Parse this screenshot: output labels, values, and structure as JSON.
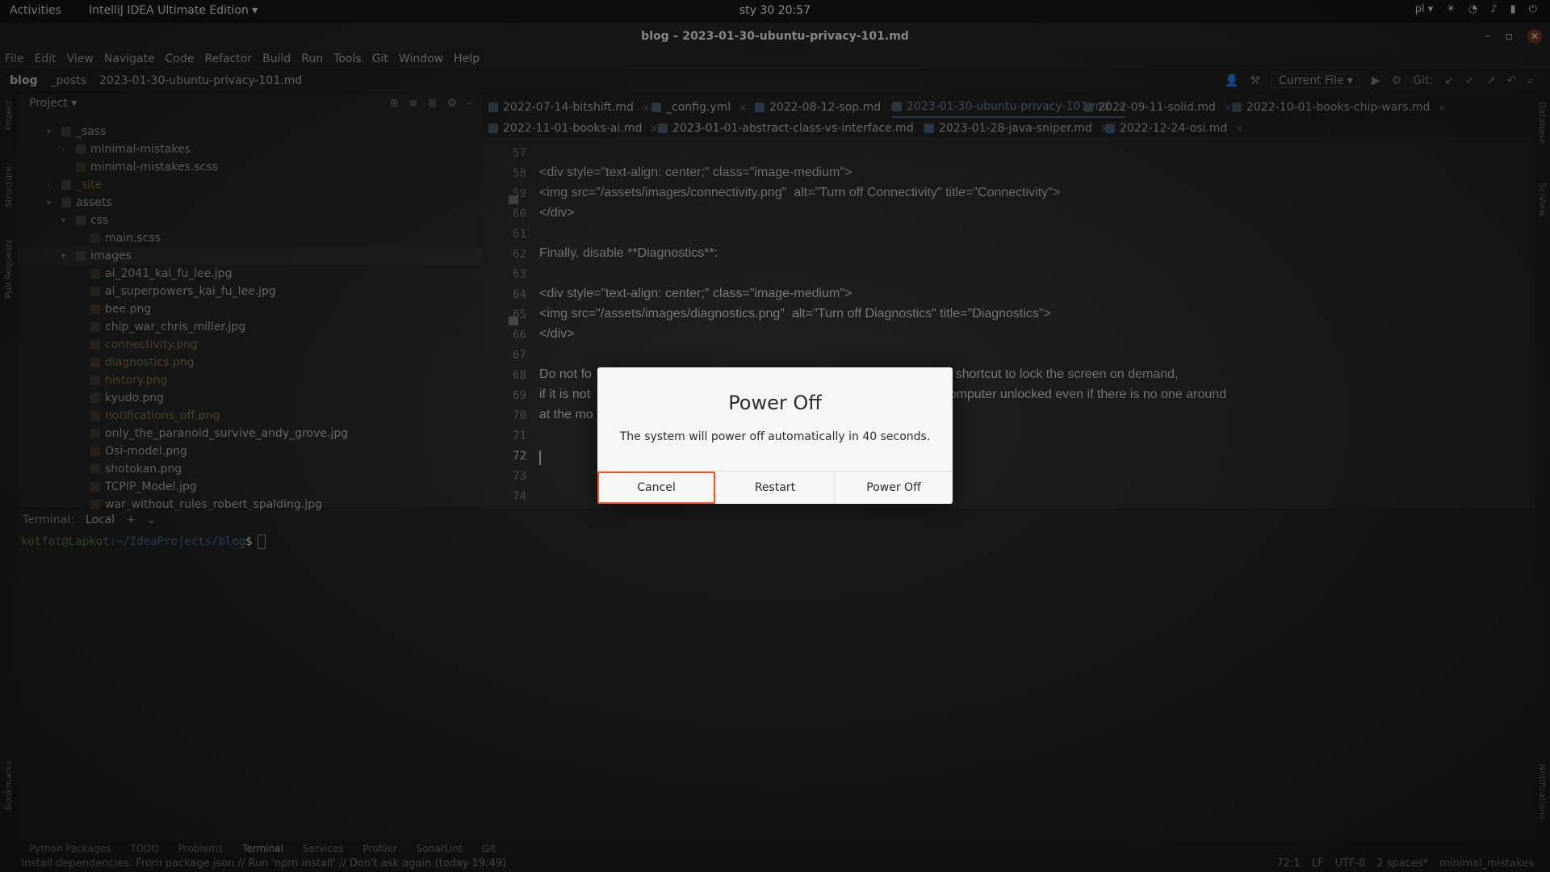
{
  "topbar": {
    "activities": "Activities",
    "app_menu": "IntelliJ IDEA Ultimate Edition ▾",
    "clock": "sty 30  20:57",
    "lang": "pl ▾"
  },
  "window": {
    "title": "blog – 2023-01-30-ubuntu-privacy-101.md"
  },
  "menu": [
    "File",
    "Edit",
    "View",
    "Navigate",
    "Code",
    "Refactor",
    "Build",
    "Run",
    "Tools",
    "Git",
    "Window",
    "Help"
  ],
  "navbar": {
    "crumbs": [
      "blog",
      "_posts",
      "2023-01-30-ubuntu-privacy-101.md"
    ],
    "run_config": "Current File ▾",
    "git_label": "Git:"
  },
  "project": {
    "header": "Project ▾",
    "rows": [
      {
        "label": "_sass",
        "indent": 1,
        "type": "folder",
        "open": true
      },
      {
        "label": "minimal-mistakes",
        "indent": 2,
        "type": "folder",
        "open": false
      },
      {
        "label": "minimal-mistakes.scss",
        "indent": 2,
        "type": "file"
      },
      {
        "label": "_site",
        "indent": 1,
        "type": "folder",
        "open": false,
        "dim": true
      },
      {
        "label": "assets",
        "indent": 1,
        "type": "folder",
        "open": true
      },
      {
        "label": "css",
        "indent": 2,
        "type": "folder",
        "open": true
      },
      {
        "label": "main.scss",
        "indent": 3,
        "type": "file"
      },
      {
        "label": "images",
        "indent": 2,
        "type": "folder",
        "open": true,
        "selected": true
      },
      {
        "label": "ai_2041_kai_fu_lee.jpg",
        "indent": 3,
        "type": "file"
      },
      {
        "label": "ai_superpowers_kai_fu_lee.jpg",
        "indent": 3,
        "type": "file"
      },
      {
        "label": "bee.png",
        "indent": 3,
        "type": "file"
      },
      {
        "label": "chip_war_chris_miller.jpg",
        "indent": 3,
        "type": "file"
      },
      {
        "label": "connectivity.png",
        "indent": 3,
        "type": "file",
        "dim": true
      },
      {
        "label": "diagnostics.png",
        "indent": 3,
        "type": "file",
        "dim": true
      },
      {
        "label": "history.png",
        "indent": 3,
        "type": "file",
        "dim": true
      },
      {
        "label": "kyudo.png",
        "indent": 3,
        "type": "file"
      },
      {
        "label": "notifications_off.png",
        "indent": 3,
        "type": "file",
        "dim": true
      },
      {
        "label": "only_the_paranoid_survive_andy_grove.jpg",
        "indent": 3,
        "type": "file"
      },
      {
        "label": "Osi-model.png",
        "indent": 3,
        "type": "file"
      },
      {
        "label": "shotokan.png",
        "indent": 3,
        "type": "file"
      },
      {
        "label": "TCPIP_Model.jpg",
        "indent": 3,
        "type": "file"
      },
      {
        "label": "war_without_rules_robert_spalding.jpg",
        "indent": 3,
        "type": "file"
      }
    ]
  },
  "tabs": [
    {
      "label": "2022-07-14-bitshift.md",
      "active": false
    },
    {
      "label": "_config.yml",
      "active": false
    },
    {
      "label": "2022-08-12-sop.md",
      "active": false
    },
    {
      "label": "2023-01-30-ubuntu-privacy-101.md",
      "active": true
    },
    {
      "label": "2022-09-11-solid.md",
      "active": false
    },
    {
      "label": "2022-10-01-books-chip-wars.md",
      "active": false
    },
    {
      "label": "2022-11-01-books-ai.md",
      "active": false
    },
    {
      "label": "2023-01-01-abstract-class-vs-interface.md",
      "active": false
    },
    {
      "label": "2023-01-28-java-sniper.md",
      "active": false
    },
    {
      "label": "2022-12-24-osi.md",
      "active": false
    }
  ],
  "editor": {
    "lines": [
      {
        "n": "57",
        "text": ""
      },
      {
        "n": "58",
        "text": "<div style=\"text-align: center;\" class=\"image-medium\">"
      },
      {
        "n": "59",
        "text": "<img src=\"/assets/images/connectivity.png\"  alt=\"Turn off Connectivity\" title=\"Connectivity\">"
      },
      {
        "n": "60",
        "text": "</div>"
      },
      {
        "n": "61",
        "text": ""
      },
      {
        "n": "62",
        "text": "Finally, disable **Diagnostics**:"
      },
      {
        "n": "63",
        "text": ""
      },
      {
        "n": "64",
        "text": "<div style=\"text-align: center;\" class=\"image-medium\">"
      },
      {
        "n": "65",
        "text": "<img src=\"/assets/images/diagnostics.png\"  alt=\"Turn off Diagnostics\" title=\"Diagnostics\">"
      },
      {
        "n": "66",
        "text": "</div>"
      },
      {
        "n": "67",
        "text": ""
      },
      {
        "n": "68",
        "text": "Do not fo                                                                        n useful keyboard shortcut to lock the screen on demand,"
      },
      {
        "n": "69",
        "text": "if it is not                                                                     Do not leave your computer unlocked even if there is no one around"
      },
      {
        "n": "70",
        "text": "at the mo"
      },
      {
        "n": "71",
        "text": ""
      },
      {
        "n": "72",
        "text": ""
      },
      {
        "n": "73",
        "text": ""
      },
      {
        "n": "74",
        "text": ""
      }
    ]
  },
  "terminal": {
    "label": "Terminal:",
    "tab": "Local",
    "user": "kotfot@Lapkot",
    "path": ":~/IdeaProjects/blog",
    "symbol": "$"
  },
  "tool_tabs": [
    "Python Packages",
    "TODO",
    "Problems",
    "Terminal",
    "Services",
    "Profiler",
    "SonarLint",
    "Git"
  ],
  "status": {
    "message": "Install dependencies: From package.json // Run 'npm install' // Don't ask again (today 19:49)",
    "position": "72:1",
    "line_sep": "LF",
    "encoding": "UTF-8",
    "indent": "2 spaces*",
    "branch": "minimal_mistakes"
  },
  "dialog": {
    "title": "Power Off",
    "body": "The system will power off automatically in 40 seconds.",
    "cancel": "Cancel",
    "restart": "Restart",
    "power_off": "Power Off"
  },
  "side_labels": {
    "project": "Project",
    "structure": "Structure",
    "pull_requests": "Pull Requests",
    "bookmarks": "Bookmarks",
    "database": "Database",
    "sciview": "SciView",
    "notifications": "Notifications"
  }
}
